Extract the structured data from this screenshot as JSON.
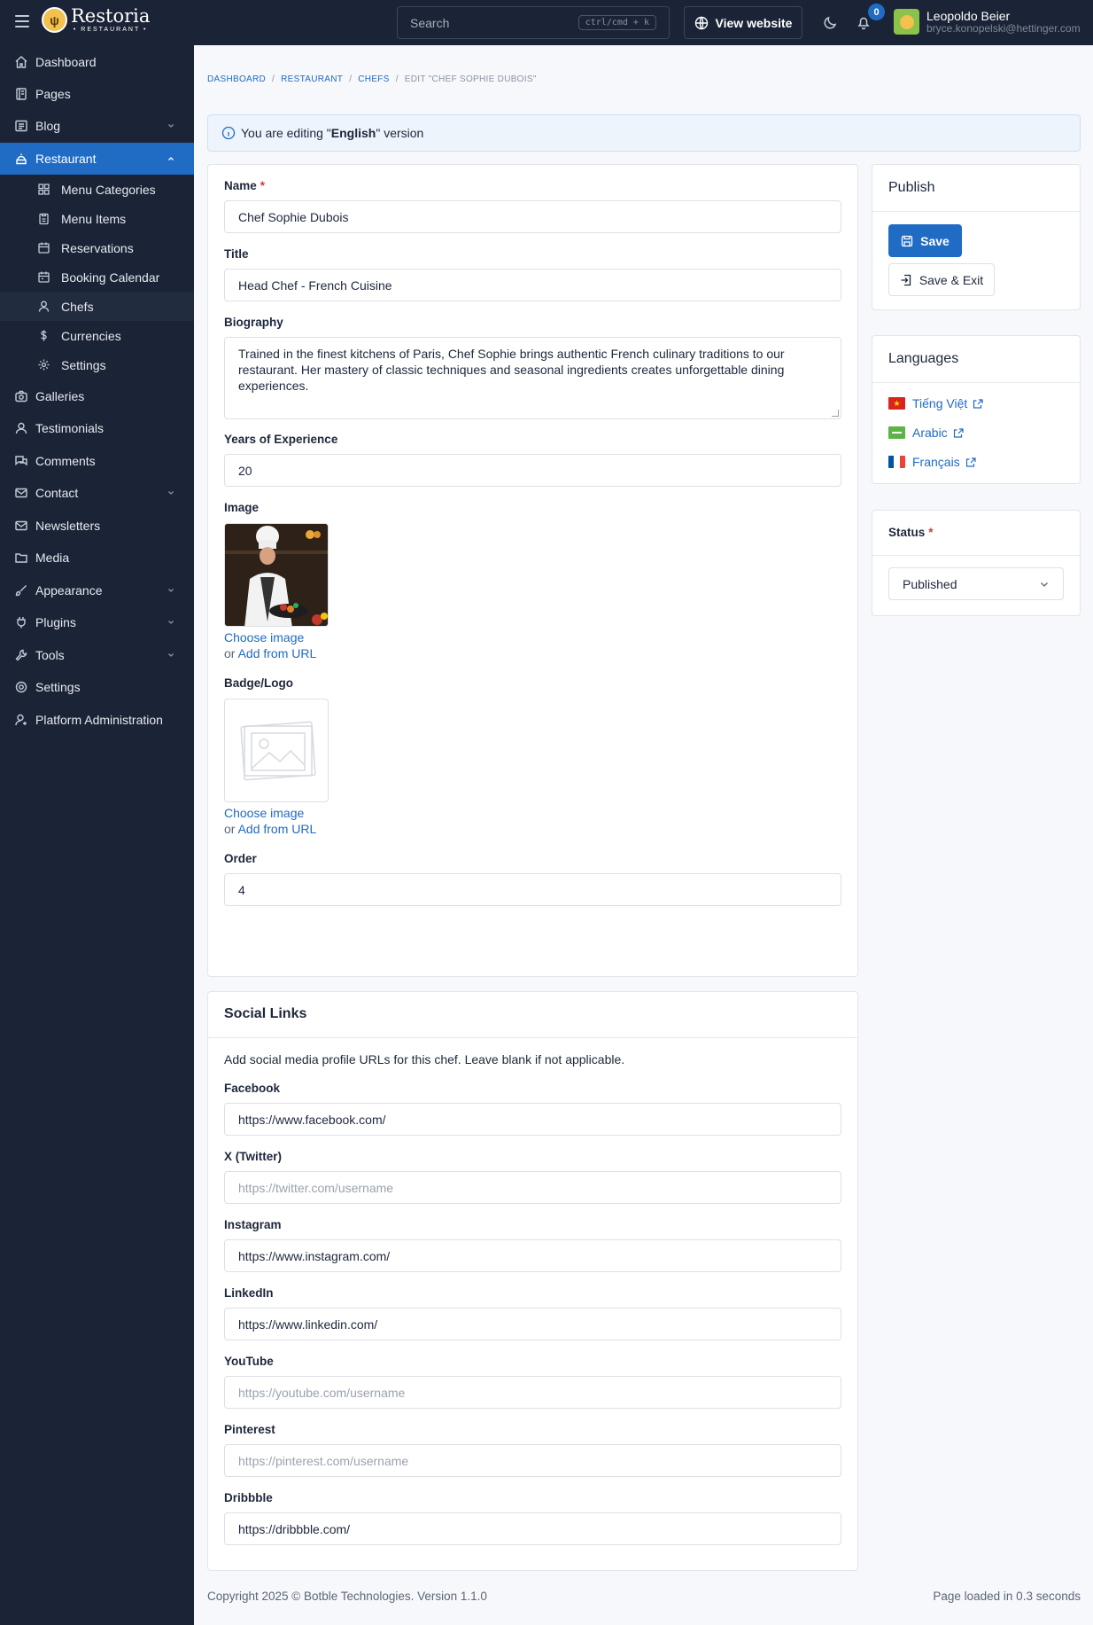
{
  "brand": {
    "name": "Restoria",
    "tagline": "• RESTAURANT •"
  },
  "topbar": {
    "search_placeholder": "Search",
    "search_shortcut": "ctrl/cmd + k",
    "view_website": "View website",
    "notifications_count": "0",
    "user_name": "Leopoldo Beier",
    "user_email": "bryce.konopelski@hettinger.com"
  },
  "sidebar": {
    "items": [
      {
        "label": "Dashboard",
        "icon": "home-icon"
      },
      {
        "label": "Pages",
        "icon": "pages-icon"
      },
      {
        "label": "Blog",
        "icon": "blog-icon"
      },
      {
        "label": "Restaurant",
        "icon": "restaurant-icon"
      },
      {
        "label": "Galleries",
        "icon": "camera-icon"
      },
      {
        "label": "Testimonials",
        "icon": "user-icon"
      },
      {
        "label": "Comments",
        "icon": "comments-icon"
      },
      {
        "label": "Contact",
        "icon": "mail-icon"
      },
      {
        "label": "Newsletters",
        "icon": "mail-icon"
      },
      {
        "label": "Media",
        "icon": "folder-icon"
      },
      {
        "label": "Appearance",
        "icon": "brush-icon"
      },
      {
        "label": "Plugins",
        "icon": "plug-icon"
      },
      {
        "label": "Tools",
        "icon": "tool-icon"
      },
      {
        "label": "Settings",
        "icon": "gear-icon"
      },
      {
        "label": "Platform Administration",
        "icon": "user-cog-icon"
      }
    ],
    "restaurant_sub": [
      {
        "label": "Menu Categories",
        "icon": "grid-icon"
      },
      {
        "label": "Menu Items",
        "icon": "clipboard-icon"
      },
      {
        "label": "Reservations",
        "icon": "calendar-icon"
      },
      {
        "label": "Booking Calendar",
        "icon": "calendar-icon"
      },
      {
        "label": "Chefs",
        "icon": "chef-icon"
      },
      {
        "label": "Currencies",
        "icon": "dollar-icon"
      },
      {
        "label": "Settings",
        "icon": "gear-icon"
      }
    ]
  },
  "breadcrumb": {
    "dashboard": "Dashboard",
    "restaurant": "Restaurant",
    "chefs": "Chefs",
    "current": "Edit \"Chef Sophie Dubois\""
  },
  "alert": {
    "prefix": "You are editing \"",
    "language": "English",
    "suffix": "\" version"
  },
  "form": {
    "name_label": "Name",
    "name_value": "Chef Sophie Dubois",
    "title_label": "Title",
    "title_value": "Head Chef - French Cuisine",
    "bio_label": "Biography",
    "bio_value": "Trained in the finest kitchens of Paris, Chef Sophie brings authentic French culinary traditions to our restaurant. Her mastery of classic techniques and seasonal ingredients creates unforgettable dining experiences.",
    "years_label": "Years of Experience",
    "years_value": "20",
    "image_label": "Image",
    "choose_image": "Choose image",
    "or_text": "or ",
    "add_from_url": "Add from URL",
    "badge_label": "Badge/Logo",
    "order_label": "Order",
    "order_value": "4"
  },
  "social": {
    "title": "Social Links",
    "help": "Add social media profile URLs for this chef. Leave blank if not applicable.",
    "fields": [
      {
        "label": "Facebook",
        "value": "https://www.facebook.com/",
        "placeholder": ""
      },
      {
        "label": "X (Twitter)",
        "value": "",
        "placeholder": "https://twitter.com/username"
      },
      {
        "label": "Instagram",
        "value": "https://www.instagram.com/",
        "placeholder": ""
      },
      {
        "label": "LinkedIn",
        "value": "https://www.linkedin.com/",
        "placeholder": ""
      },
      {
        "label": "YouTube",
        "value": "",
        "placeholder": "https://youtube.com/username"
      },
      {
        "label": "Pinterest",
        "value": "",
        "placeholder": "https://pinterest.com/username"
      },
      {
        "label": "Dribbble",
        "value": "https://dribbble.com/",
        "placeholder": ""
      }
    ]
  },
  "publish": {
    "title": "Publish",
    "save": "Save",
    "save_exit": "Save & Exit"
  },
  "languages": {
    "title": "Languages",
    "items": [
      {
        "label": "Tiếng Việt",
        "flag": "flag-vn-icon"
      },
      {
        "label": "Arabic",
        "flag": "flag-ar-icon"
      },
      {
        "label": "Français",
        "flag": "flag-fr-icon"
      }
    ]
  },
  "status": {
    "label": "Status",
    "value": "Published"
  },
  "footer": {
    "copyright": "Copyright 2025 © Botble Technologies. Version 1.1.0",
    "load_time": "Page loaded in 0.3 seconds"
  },
  "colors": {
    "primary": "#206bc4",
    "sidebar_bg": "#1b2436",
    "required": "#d63939"
  }
}
